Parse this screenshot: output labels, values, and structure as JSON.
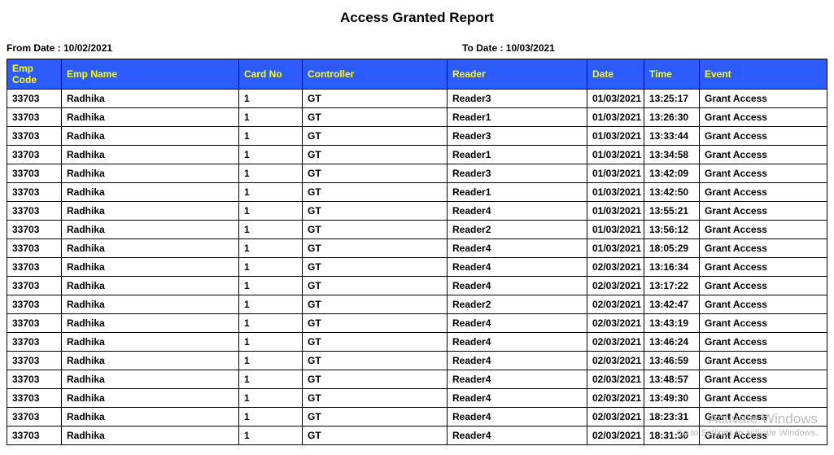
{
  "title": "Access Granted Report",
  "from_date_label": "From Date : 10/02/2021",
  "to_date_label": "To Date : 10/03/2021",
  "headers": {
    "emp_code": "Emp Code",
    "emp_name": "Emp Name",
    "card_no": "Card No",
    "controller": "Controller",
    "reader": "Reader",
    "date": "Date",
    "time": "Time",
    "event": "Event"
  },
  "rows": [
    {
      "emp_code": "33703",
      "emp_name": "Radhika",
      "card_no": "1",
      "controller": "GT",
      "reader": "Reader3",
      "date": "01/03/2021",
      "time": "13:25:17",
      "event": "Grant Access"
    },
    {
      "emp_code": "33703",
      "emp_name": "Radhika",
      "card_no": "1",
      "controller": "GT",
      "reader": "Reader1",
      "date": "01/03/2021",
      "time": "13:26:30",
      "event": "Grant Access"
    },
    {
      "emp_code": "33703",
      "emp_name": "Radhika",
      "card_no": "1",
      "controller": "GT",
      "reader": "Reader3",
      "date": "01/03/2021",
      "time": "13:33:44",
      "event": "Grant Access"
    },
    {
      "emp_code": "33703",
      "emp_name": "Radhika",
      "card_no": "1",
      "controller": "GT",
      "reader": "Reader1",
      "date": "01/03/2021",
      "time": "13:34:58",
      "event": "Grant Access"
    },
    {
      "emp_code": "33703",
      "emp_name": "Radhika",
      "card_no": "1",
      "controller": "GT",
      "reader": "Reader3",
      "date": "01/03/2021",
      "time": "13:42:09",
      "event": "Grant Access"
    },
    {
      "emp_code": "33703",
      "emp_name": "Radhika",
      "card_no": "1",
      "controller": "GT",
      "reader": "Reader1",
      "date": "01/03/2021",
      "time": "13:42:50",
      "event": "Grant Access"
    },
    {
      "emp_code": "33703",
      "emp_name": "Radhika",
      "card_no": "1",
      "controller": "GT",
      "reader": "Reader4",
      "date": "01/03/2021",
      "time": "13:55:21",
      "event": "Grant Access"
    },
    {
      "emp_code": "33703",
      "emp_name": "Radhika",
      "card_no": "1",
      "controller": "GT",
      "reader": "Reader2",
      "date": "01/03/2021",
      "time": "13:56:12",
      "event": "Grant Access"
    },
    {
      "emp_code": "33703",
      "emp_name": "Radhika",
      "card_no": "1",
      "controller": "GT",
      "reader": "Reader4",
      "date": "01/03/2021",
      "time": "18:05:29",
      "event": "Grant Access"
    },
    {
      "emp_code": "33703",
      "emp_name": "Radhika",
      "card_no": "1",
      "controller": "GT",
      "reader": "Reader4",
      "date": "02/03/2021",
      "time": "13:16:34",
      "event": "Grant Access"
    },
    {
      "emp_code": "33703",
      "emp_name": "Radhika",
      "card_no": "1",
      "controller": "GT",
      "reader": "Reader4",
      "date": "02/03/2021",
      "time": "13:17:22",
      "event": "Grant Access"
    },
    {
      "emp_code": "33703",
      "emp_name": "Radhika",
      "card_no": "1",
      "controller": "GT",
      "reader": "Reader2",
      "date": "02/03/2021",
      "time": "13:42:47",
      "event": "Grant Access"
    },
    {
      "emp_code": "33703",
      "emp_name": "Radhika",
      "card_no": "1",
      "controller": "GT",
      "reader": "Reader4",
      "date": "02/03/2021",
      "time": "13:43:19",
      "event": "Grant Access"
    },
    {
      "emp_code": "33703",
      "emp_name": "Radhika",
      "card_no": "1",
      "controller": "GT",
      "reader": "Reader4",
      "date": "02/03/2021",
      "time": "13:46:24",
      "event": "Grant Access"
    },
    {
      "emp_code": "33703",
      "emp_name": "Radhika",
      "card_no": "1",
      "controller": "GT",
      "reader": "Reader4",
      "date": "02/03/2021",
      "time": "13:46:59",
      "event": "Grant Access"
    },
    {
      "emp_code": "33703",
      "emp_name": "Radhika",
      "card_no": "1",
      "controller": "GT",
      "reader": "Reader4",
      "date": "02/03/2021",
      "time": "13:48:57",
      "event": "Grant Access"
    },
    {
      "emp_code": "33703",
      "emp_name": "Radhika",
      "card_no": "1",
      "controller": "GT",
      "reader": "Reader4",
      "date": "02/03/2021",
      "time": "13:49:30",
      "event": "Grant Access"
    },
    {
      "emp_code": "33703",
      "emp_name": "Radhika",
      "card_no": "1",
      "controller": "GT",
      "reader": "Reader4",
      "date": "02/03/2021",
      "time": "18:23:31",
      "event": "Grant Access"
    },
    {
      "emp_code": "33703",
      "emp_name": "Radhika",
      "card_no": "1",
      "controller": "GT",
      "reader": "Reader4",
      "date": "02/03/2021",
      "time": "18:31:30",
      "event": "Grant Access"
    }
  ],
  "watermark": {
    "line1": "Activate Windows",
    "line2": "Go to Settings to activate Windows."
  }
}
